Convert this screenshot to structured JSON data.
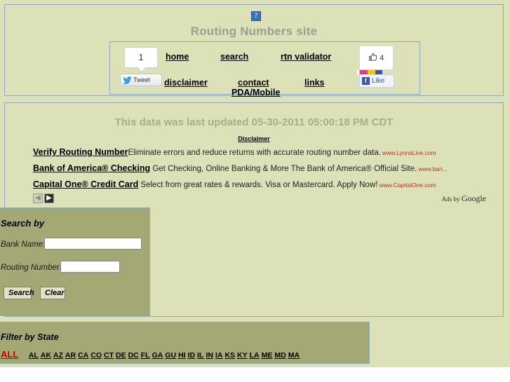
{
  "header": {
    "broken_image_glyph": "?",
    "site_title": "Routing Numbers site",
    "nav": {
      "home": "home",
      "search": "search",
      "validator": "rtn validator",
      "disclaimer": "disclaimer",
      "contact": "contact",
      "links": "links",
      "pda": "PDA/Mobile"
    },
    "twitter": {
      "count": "1",
      "button_label": "Tweet",
      "bird_glyph": "ᵕ"
    },
    "facebook": {
      "count": "4",
      "thumb_glyph": "👍",
      "like_label": "Like",
      "icon_glyph": "f"
    }
  },
  "content": {
    "last_updated": "This data was last updated 05-30-2011 05:00:18 PM CDT",
    "disclaimer_heading": "Disclaimer",
    "ads": [
      {
        "title": "Verify Routing Number",
        "text": "Eliminate errors and reduce returns with accurate routing number data.",
        "url": "www.LyonsLive.com"
      },
      {
        "title": "Bank of America® Checking",
        "text": "Get Checking, Online Banking & More The Bank of America® Official Site.",
        "url": "www.ban..."
      },
      {
        "title": "Capital One® Credit Card",
        "text": "Select from great rates & rewards. Visa or Mastercard. Apply Now!",
        "url": "www.CapitalOne.com"
      }
    ],
    "ad_nav": {
      "prev_glyph": "◀",
      "next_glyph": "▶"
    },
    "ads_by": {
      "prefix": "Ads by ",
      "brand": "Google"
    }
  },
  "search_panel": {
    "title": "Search by",
    "bank_name_label": "Bank Name:",
    "bank_name_value": "",
    "bank_name_placeholder": "",
    "routing_number_label": "Routing Number:",
    "routing_number_value": "",
    "routing_number_placeholder": "",
    "search_button": "Search",
    "clear_button": "Clear"
  },
  "state_panel": {
    "title": "Filter by State",
    "all_label": "ALL",
    "states": [
      "AL",
      "AK",
      "AZ",
      "AR",
      "CA",
      "CO",
      "CT",
      "DE",
      "DC",
      "FL",
      "GA",
      "GU",
      "HI",
      "ID",
      "IL",
      "IN",
      "IA",
      "KS",
      "KY",
      "LA",
      "ME",
      "MD",
      "MA"
    ]
  },
  "colors": {
    "page_background": "#dce1b8",
    "panel_background": "#a3a874",
    "panel_border": "#8faabd",
    "title_gray": "#9d9d91",
    "updated_gray": "#a8ad8a",
    "ad_url_red": "#b4341c",
    "all_link_red": "#cc0000"
  }
}
